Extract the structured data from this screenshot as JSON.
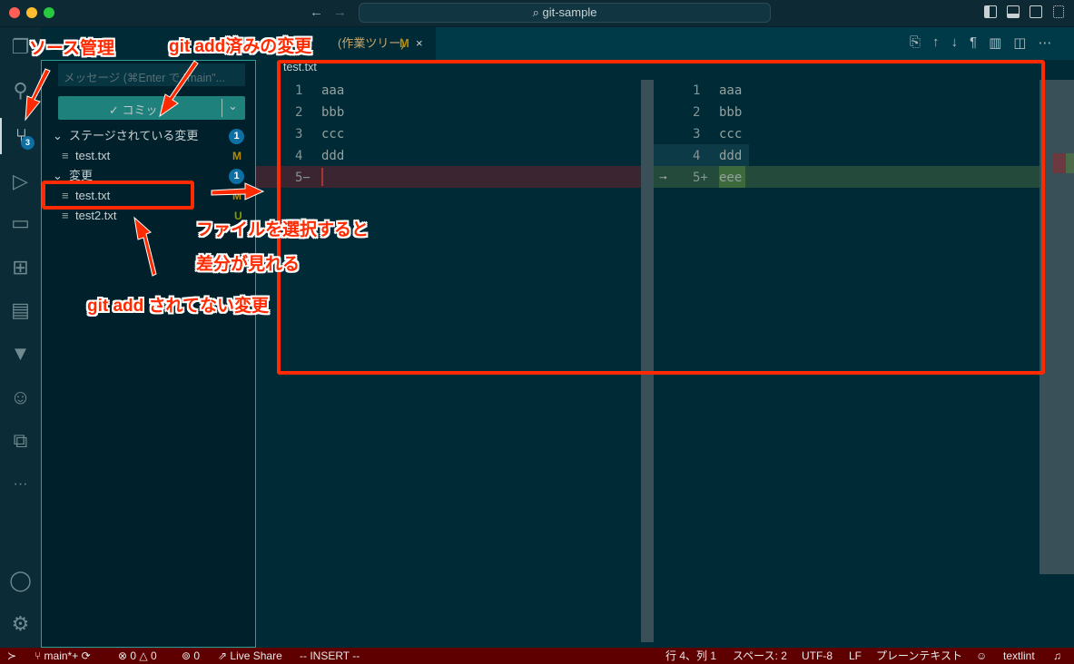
{
  "title": {
    "search": "git-sample",
    "nav_back": "←",
    "nav_fwd": "→"
  },
  "activity": {
    "scm_badge": "3",
    "more": "···"
  },
  "sidebar": {
    "message_placeholder": "メッセージ (⌘Enter で \"main\"...",
    "commit_label": "✓ コミット",
    "staged": {
      "label": "ステージされている変更",
      "count": "1",
      "files": [
        {
          "name": "test.txt",
          "status": "M"
        }
      ]
    },
    "changes": {
      "label": "変更",
      "count": "1",
      "files": [
        {
          "name": "test.txt",
          "status": "M"
        },
        {
          "name": "test2.txt",
          "status": "U"
        }
      ]
    }
  },
  "tab": {
    "label": "(作業ツリー)",
    "status": "M",
    "close": "×"
  },
  "editor": {
    "breadcrumb": "test.txt",
    "left": [
      {
        "n": "1",
        "t": "aaa"
      },
      {
        "n": "2",
        "t": "bbb"
      },
      {
        "n": "3",
        "t": "ccc"
      },
      {
        "n": "4",
        "t": "ddd"
      },
      {
        "n": "5−",
        "t": ""
      }
    ],
    "right": [
      {
        "n": "1",
        "t": "aaa"
      },
      {
        "n": "2",
        "t": "bbb"
      },
      {
        "n": "3",
        "t": "ccc"
      },
      {
        "n": "4",
        "t": "ddd"
      },
      {
        "n": "5+",
        "t": "eee"
      }
    ]
  },
  "status": {
    "branch": "main*+",
    "errors": "0",
    "warnings": "0",
    "ports": "0",
    "liveshare": "Live Share",
    "mode": "-- INSERT --",
    "position": "行 4、列 1",
    "spaces": "スペース: 2",
    "encoding": "UTF-8",
    "eol": "LF",
    "language": "プレーンテキスト",
    "linter": "textlint"
  },
  "annotations": {
    "scm": "ソース管理",
    "staged": "git add済みの変更",
    "select": "ファイルを選択すると",
    "diff": "差分が見れる",
    "unstaged": "git add されてない変更"
  },
  "colors": {
    "accent": "#2aa198",
    "status_bar": "#5e0000",
    "annotation": "#ff2a00",
    "added": "#2b4a3a",
    "removed": "#3a2530"
  }
}
